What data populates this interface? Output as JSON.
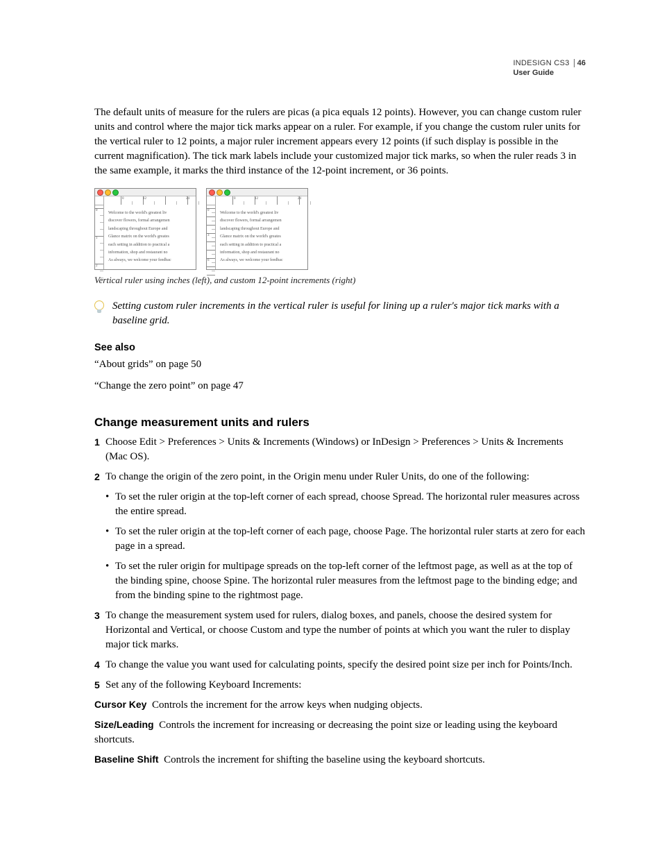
{
  "header": {
    "product": "INDESIGN CS3",
    "subtitle": "User Guide",
    "page_number": "46"
  },
  "intro_paragraph": "The default units of measure for the rulers are picas (a pica equals 12 points). However, you can change custom ruler units and control where the major tick marks appear on a ruler. For example, if you change the custom ruler units for the vertical ruler to 12 points, a major ruler increment appears every 12 points (if such display is possible in the current magnification). The tick mark labels include your customized major tick marks, so when the ruler reads 3 in the same example, it marks the third instance of the 12-point increment, or 36 points.",
  "figure": {
    "sample_lines": [
      "Welcome to the world's greatest liv",
      "discover flowers, formal arrangemen",
      "landscaping throughout Europe and",
      "Glance matrix on the world's greates",
      "each setting in addition to practical a",
      "information, shop and restaurant no",
      "As always, we welcome your feedbac"
    ],
    "caption": "Vertical ruler using inches (left), and custom 12-point increments (right)"
  },
  "tip_text": "Setting custom ruler increments in the vertical ruler is useful for lining up a ruler's major tick marks with a baseline grid.",
  "see_also": {
    "heading": "See also",
    "links": [
      "“About grids” on page 50",
      "“Change the zero point” on page 47"
    ]
  },
  "section": {
    "heading": "Change measurement units and rulers",
    "steps": {
      "s1_num": "1",
      "s1": "Choose Edit > Preferences > Units & Increments (Windows) or InDesign > Preferences > Units & Increments (Mac OS).",
      "s2_num": "2",
      "s2": "To change the origin of the zero point, in the Origin menu under Ruler Units, do one of the following:",
      "s2_bullets": [
        "To set the ruler origin at the top-left corner of each spread, choose Spread. The horizontal ruler measures across the entire spread.",
        "To set the ruler origin at the top-left corner of each page, choose Page. The horizontal ruler starts at zero for each page in a spread.",
        "To set the ruler origin for multipage spreads on the top-left corner of the leftmost page, as well as at the top of the binding spine, choose Spine. The horizontal ruler measures from the leftmost page to the binding edge; and from the binding spine to the rightmost page."
      ],
      "s3_num": "3",
      "s3": "To change the measurement system used for rulers, dialog boxes, and panels, choose the desired system for Horizontal and Vertical, or choose Custom and type the number of points at which you want the ruler to display major tick marks.",
      "s4_num": "4",
      "s4": "To change the value you want used for calculating points, specify the desired point size per inch for Points/Inch.",
      "s5_num": "5",
      "s5": "Set any of the following Keyboard Increments:"
    },
    "definitions": [
      {
        "term": "Cursor Key",
        "desc": "Controls the increment for the arrow keys when nudging objects."
      },
      {
        "term": "Size/Leading",
        "desc": "Controls the increment for increasing or decreasing the point size or leading using the keyboard shortcuts."
      },
      {
        "term": "Baseline Shift",
        "desc": "Controls the increment for shifting the baseline using the keyboard shortcuts."
      }
    ]
  }
}
